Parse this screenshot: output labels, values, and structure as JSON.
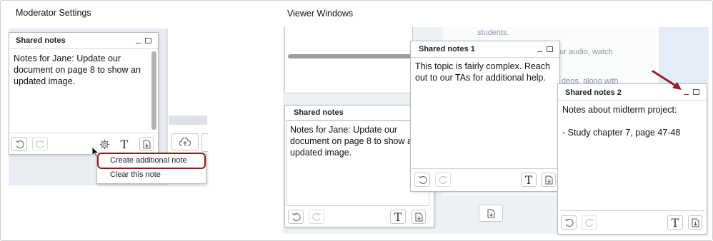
{
  "captions": {
    "left": "Moderator Settings",
    "right": "Viewer Windows"
  },
  "moderator": {
    "title": "Shared notes",
    "note_text": "Notes for Jane: Update our document on page 8 to show an updated image.",
    "menu": [
      "Create additional note",
      "Clear this note"
    ]
  },
  "viewer": {
    "background_text": [
      "students.",
      "our audio, watch",
      "deos, along with"
    ],
    "main": {
      "title": "Shared notes",
      "note_text": "Notes for Jane: Update our document on page 8 to show an updated image."
    },
    "note1": {
      "title": "Shared notes 1",
      "note_text": "This topic is fairly complex. Reach out to our TAs for additional help."
    },
    "note2": {
      "title": "Shared notes 2",
      "note_text": "Notes about midterm project:\n\n- Study chapter 7, page 47-48"
    }
  },
  "toolbar": {
    "format_label": "T"
  },
  "colors": {
    "highlight": "#8e1d1d",
    "arrow": "#9b1c24",
    "panel_bg": "#e9edf1"
  },
  "icons": [
    "undo-icon",
    "redo-icon",
    "gear-icon",
    "format-text-icon",
    "export-icon",
    "upload-cloud-icon",
    "cursor-icon",
    "arrow-pointer"
  ]
}
